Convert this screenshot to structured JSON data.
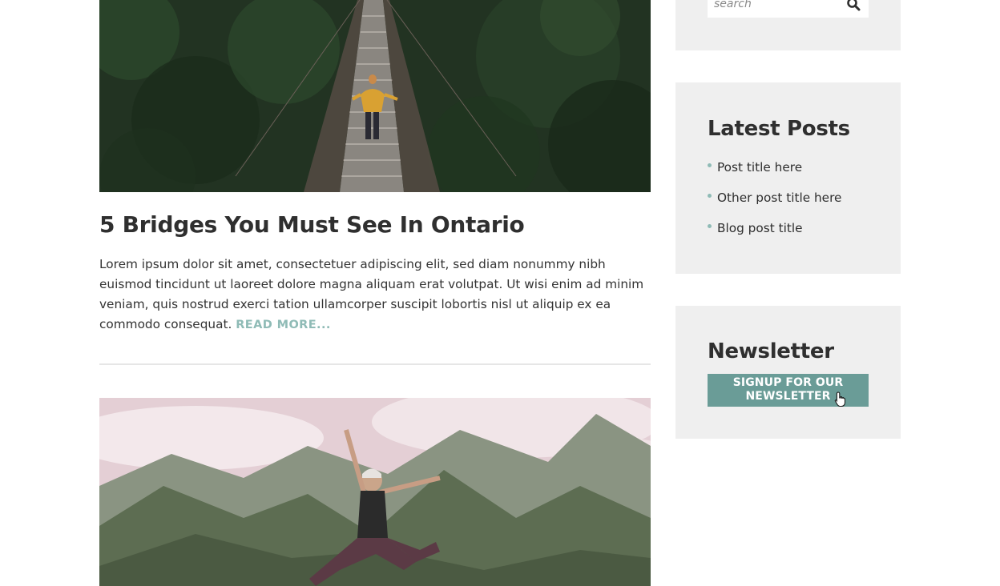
{
  "posts": [
    {
      "image_alt": "Person on a suspension bridge in a forest",
      "title": "5 Bridges You Must See In Ontario",
      "excerpt": "Lorem ipsum dolor sit amet, consectetuer adipiscing elit, sed diam nonummy nibh euismod tincidunt ut laoreet dolore magna aliquam erat volutpat. Ut wisi enim ad minim veniam, quis nostrud exerci tation ullamcorper suscipit lobortis nisl ut aliquip ex ea commodo consequat.",
      "read_more": "READ MORE..."
    },
    {
      "image_alt": "Person jumping in front of mountains"
    }
  ],
  "sidebar": {
    "search": {
      "placeholder": "search",
      "icon": "search-icon"
    },
    "latest_posts": {
      "title": "Latest Posts",
      "items": [
        "Post title here",
        "Other post title here",
        "Blog post title"
      ]
    },
    "newsletter": {
      "title": "Newsletter",
      "button_line1": "SIGNUP FOR OUR",
      "button_line2": "NEWSLETTER"
    }
  },
  "colors": {
    "accent": "#8fbbb6",
    "button": "#6a9c97",
    "widget_bg": "#efefef",
    "text": "#2f2f2f"
  }
}
